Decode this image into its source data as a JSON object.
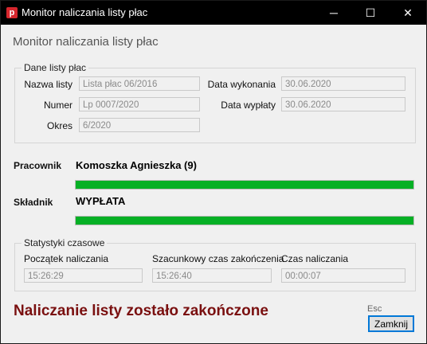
{
  "window": {
    "title": "Monitor naliczania listy płac",
    "icon_letter": "p",
    "controls": {
      "minimize": "─",
      "maximize": "☐",
      "close": "✕"
    }
  },
  "heading": "Monitor naliczania listy płac",
  "payroll": {
    "legend": "Dane listy płac",
    "name_label": "Nazwa listy",
    "name_value": "Lista płac 06/2016",
    "number_label": "Numer",
    "number_value": "Lp 0007/2020",
    "period_label": "Okres",
    "period_value": "6/2020",
    "exec_date_label": "Data wykonania",
    "exec_date_value": "30.06.2020",
    "pay_date_label": "Data wypłaty",
    "pay_date_value": "30.06.2020"
  },
  "employee": {
    "label": "Pracownik",
    "value": "Komoszka Agnieszka (9)",
    "progress": 1.0
  },
  "component": {
    "label": "Składnik",
    "value": "WYPŁATA",
    "progress": 1.0
  },
  "stats": {
    "legend": "Statystyki czasowe",
    "start_label": "Początek naliczania",
    "start_value": "15:26:29",
    "eta_label": "Szacunkowy czas zakończenia",
    "eta_value": "15:26:40",
    "duration_label": "Czas naliczania",
    "duration_value": "00:00:07"
  },
  "status_message": "Naliczanie listy zostało zakończone",
  "colors": {
    "progress": "#06b025",
    "status": "#7a1010"
  },
  "footer": {
    "esc_hint": "Esc",
    "close_label": "Zamknij"
  }
}
